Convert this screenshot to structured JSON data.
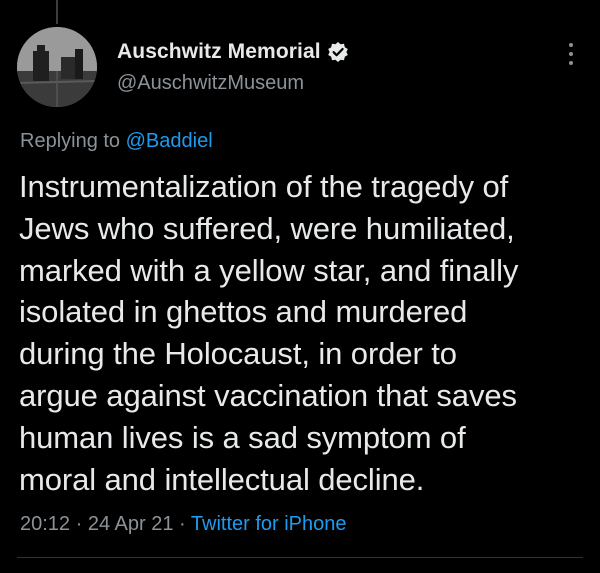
{
  "tweet": {
    "author": {
      "display_name": "Auschwitz Memorial",
      "handle": "@AuschwitzMuseum",
      "verified_icon": "verified-badge-icon",
      "avatar_icon": "profile-photo"
    },
    "reply": {
      "prefix": "Replying to ",
      "mention": "@Baddiel"
    },
    "text": "Instrumentalization of the tragedy of\nJews who suffered, were humiliated,\nmarked with a yellow star, and finally\nisolated in ghettos and murdered\nduring the Holocaust, in order to\nargue against vaccination that saves\nhuman lives is a sad symptom of\nmoral and intellectual decline.",
    "time": "20:12",
    "separator": " · ",
    "date": "24 Apr 21",
    "source": "Twitter for iPhone"
  },
  "colors": {
    "background": "#000000",
    "primary_text": "#e7e9ea",
    "secondary_text": "#8b9298",
    "accent": "#1d9bf0"
  }
}
